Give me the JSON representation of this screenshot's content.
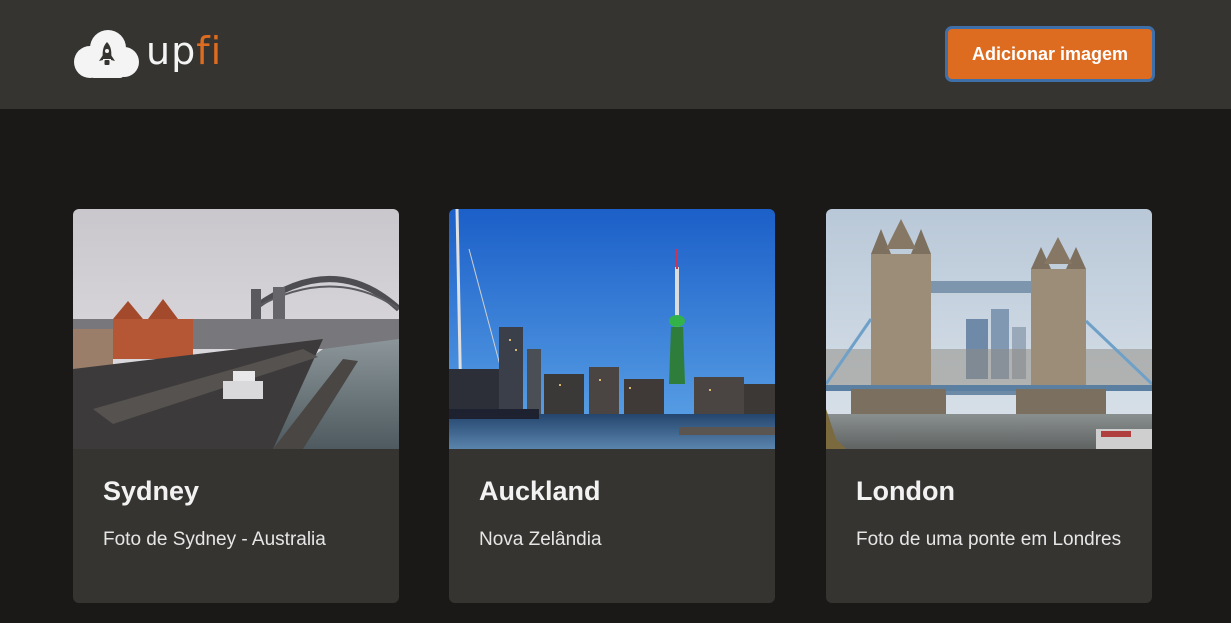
{
  "header": {
    "logo": {
      "text_up": "up",
      "text_fi": "fi"
    },
    "add_button_label": "Adicionar imagem"
  },
  "colors": {
    "accent": "#dd6b20",
    "header_bg": "#353431",
    "page_bg": "#1b1918",
    "card_bg": "#353431"
  },
  "cards": [
    {
      "title": "Sydney",
      "description": "Foto de Sydney - Australia"
    },
    {
      "title": "Auckland",
      "description": "Nova Zelândia"
    },
    {
      "title": "London",
      "description": "Foto de uma ponte em Londres"
    }
  ]
}
